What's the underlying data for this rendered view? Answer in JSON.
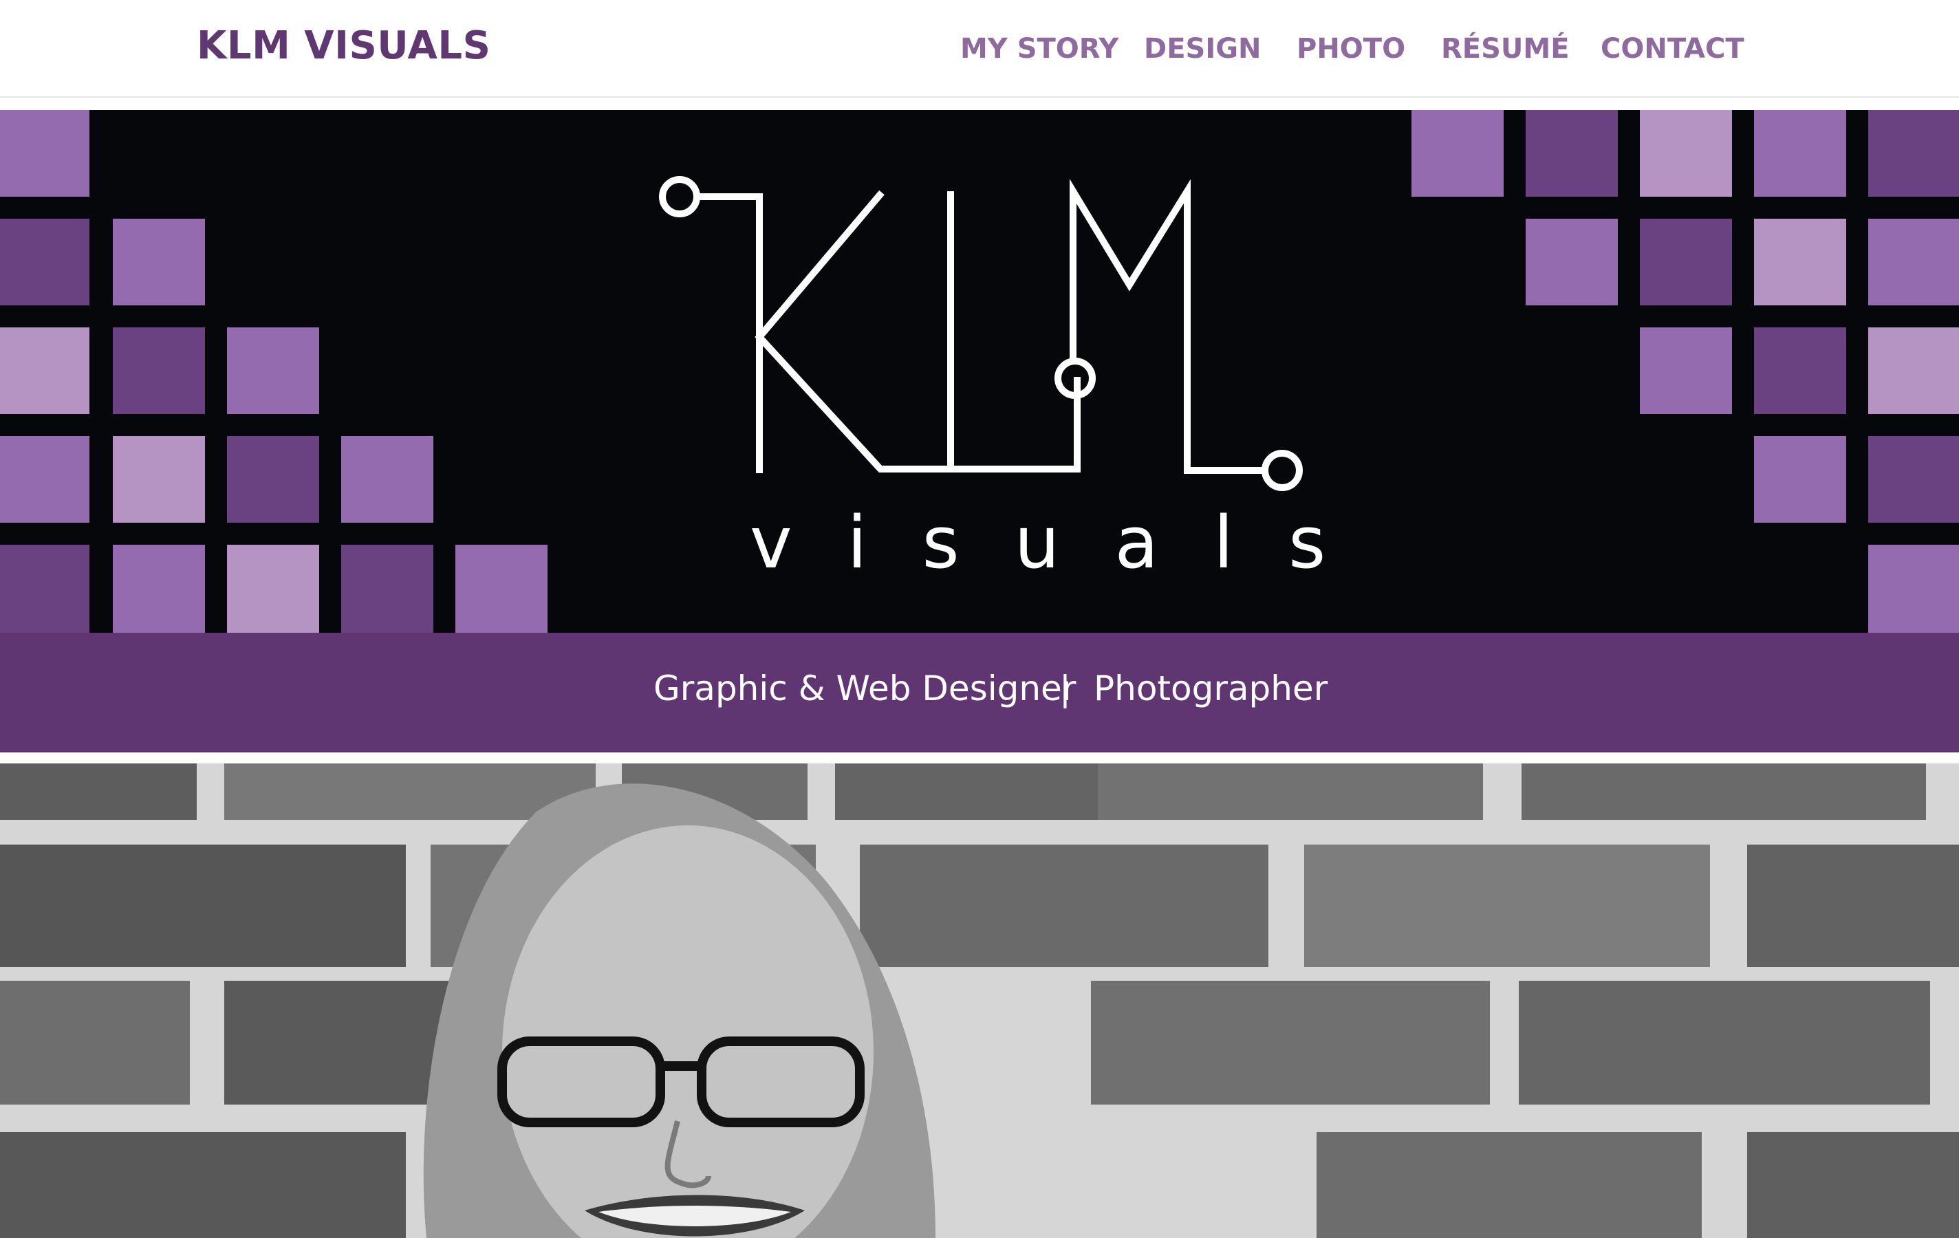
{
  "header": {
    "brand": "KLM VISUALS",
    "nav": [
      {
        "label": "MY STORY"
      },
      {
        "label": "DESIGN"
      },
      {
        "label": "PHOTO"
      },
      {
        "label": "RÉSUMÉ"
      },
      {
        "label": "CONTACT"
      }
    ]
  },
  "hero": {
    "logo_text": "visuals"
  },
  "tagline": {
    "left": "Graphic & Web Designer",
    "separator": "|",
    "right": "Photographer"
  },
  "colors": {
    "brand": "#5f3872",
    "nav": "#8e6a9e",
    "hero_bg": "#06070a",
    "band": "#5f3672",
    "tile_mid": "#946bae",
    "tile_dark": "#6a4282",
    "tile_light": "#b594c4"
  },
  "photo": {
    "icon": "portrait-photo"
  }
}
